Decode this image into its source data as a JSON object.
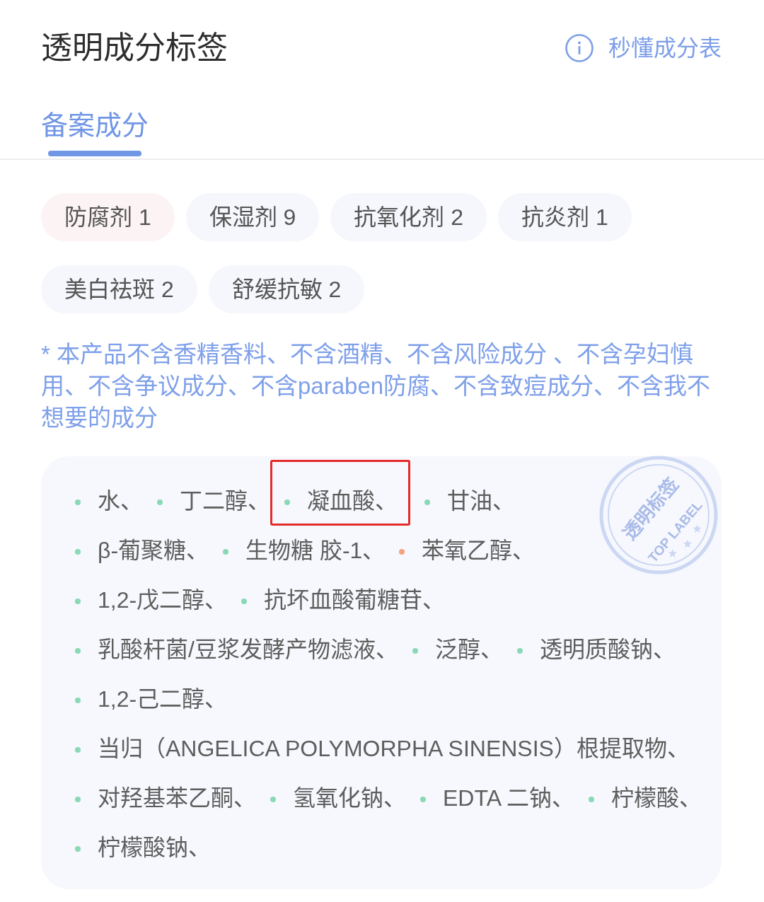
{
  "header": {
    "title": "透明成分标签",
    "guide_link": "秒懂成分表"
  },
  "tabs": [
    {
      "label": "备案成分",
      "selected": true
    }
  ],
  "categories": [
    {
      "label": "防腐剂 1",
      "color": "#fcf4f4"
    },
    {
      "label": "保湿剂 9",
      "color": "#f5f7fc"
    },
    {
      "label": "抗氧化剂 2",
      "color": "#f5f7fc"
    },
    {
      "label": "抗炎剂 1",
      "color": "#f5f7fc"
    },
    {
      "label": "美白祛斑 2",
      "color": "#f5f7fc"
    },
    {
      "label": "舒缓抗敏 2",
      "color": "#f5f7fc"
    }
  ],
  "note": "* 本产品不含香精香料、不含酒精、不含风险成分 、不含孕妇慎用、不含争议成分、不含paraben防腐、不含致痘成分、不含我不想要的成分",
  "stamp": {
    "title": "透明标签",
    "subtitle": "TOP LABEL"
  },
  "ingredients": [
    {
      "name": "水、",
      "color": "#8ad9b6",
      "highlighted": false
    },
    {
      "name": "丁二醇、",
      "color": "#8ad9b6",
      "highlighted": false
    },
    {
      "name": "凝血酸、",
      "color": "#8ad9b6",
      "highlighted": true
    },
    {
      "name": "甘油、",
      "color": "#8ad9b6",
      "highlighted": false
    },
    {
      "name": "β-葡聚糖、",
      "color": "#8ad9b6",
      "highlighted": false
    },
    {
      "name": "生物糖 胶-1、",
      "color": "#8ad9b6",
      "highlighted": false
    },
    {
      "name": "苯氧乙醇、",
      "color": "#f3a27e",
      "highlighted": false
    },
    {
      "name": "1,2-戊二醇、",
      "color": "#8ad9b6",
      "highlighted": false
    },
    {
      "name": "抗坏血酸葡糖苷、",
      "color": "#8ad9b6",
      "highlighted": false
    },
    {
      "name": "乳酸杆菌/豆浆发酵产物滤液、",
      "color": "#8ad9b6",
      "highlighted": false
    },
    {
      "name": "泛醇、",
      "color": "#8ad9b6",
      "highlighted": false
    },
    {
      "name": "透明质酸钠、",
      "color": "#8ad9b6",
      "highlighted": false
    },
    {
      "name": "1,2-己二醇、",
      "color": "#8ad9b6",
      "highlighted": false
    },
    {
      "name": "当归（ANGELICA POLYMORPHA SINENSIS）根提取物、",
      "color": "#8ad9b6",
      "highlighted": false
    },
    {
      "name": "对羟基苯乙酮、",
      "color": "#8ad9b6",
      "highlighted": false
    },
    {
      "name": "氢氧化钠、",
      "color": "#8ad9b6",
      "highlighted": false
    },
    {
      "name": "EDTA 二钠、",
      "color": "#8ad9b6",
      "highlighted": false
    },
    {
      "name": "柠檬酸、",
      "color": "#8ad9b6",
      "highlighted": false
    },
    {
      "name": "柠檬酸钠、",
      "color": "#8ad9b6",
      "highlighted": false
    }
  ]
}
